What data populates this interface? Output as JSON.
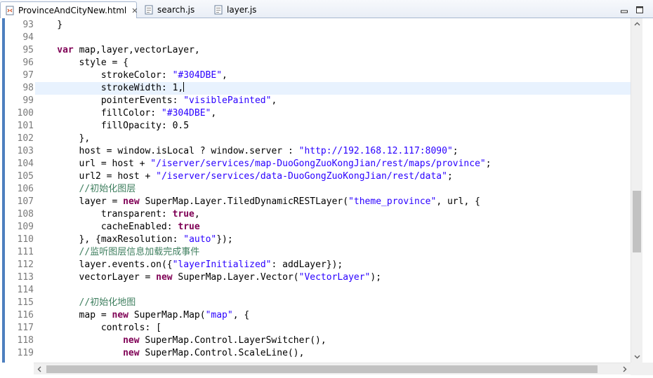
{
  "tabs": [
    {
      "label": "ProvinceAndCityNew.html",
      "icon": "html-file-icon",
      "active": true,
      "closable": true
    },
    {
      "label": "search.js",
      "icon": "js-file-icon",
      "active": false
    },
    {
      "label": "layer.js",
      "icon": "js-file-icon",
      "active": false
    }
  ],
  "window_controls": [
    "minimize-icon",
    "maximize-icon"
  ],
  "editor": {
    "current_line": 98,
    "lines": [
      {
        "n": "93",
        "indent": 1,
        "tokens": [
          {
            "t": "}",
            "c": "plain"
          }
        ]
      },
      {
        "n": "94",
        "indent": 0,
        "tokens": []
      },
      {
        "n": "95",
        "indent": 1,
        "tokens": [
          {
            "t": "var",
            "c": "kw"
          },
          {
            "t": " map,layer,vectorLayer,",
            "c": "plain"
          }
        ]
      },
      {
        "n": "96",
        "indent": 2,
        "tokens": [
          {
            "t": "style = {",
            "c": "plain"
          }
        ]
      },
      {
        "n": "97",
        "indent": 3,
        "tokens": [
          {
            "t": "strokeColor: ",
            "c": "plain"
          },
          {
            "t": "\"#304DBE\"",
            "c": "str"
          },
          {
            "t": ",",
            "c": "plain"
          }
        ]
      },
      {
        "n": "98",
        "indent": 3,
        "tokens": [
          {
            "t": "strokeWidth: 1,",
            "c": "plain"
          }
        ],
        "caret": true
      },
      {
        "n": "99",
        "indent": 3,
        "tokens": [
          {
            "t": "pointerEvents: ",
            "c": "plain"
          },
          {
            "t": "\"visiblePainted\"",
            "c": "str"
          },
          {
            "t": ",",
            "c": "plain"
          }
        ]
      },
      {
        "n": "100",
        "indent": 3,
        "tokens": [
          {
            "t": "fillColor: ",
            "c": "plain"
          },
          {
            "t": "\"#304DBE\"",
            "c": "str"
          },
          {
            "t": ",",
            "c": "plain"
          }
        ]
      },
      {
        "n": "101",
        "indent": 3,
        "tokens": [
          {
            "t": "fillOpacity: 0.5",
            "c": "plain"
          }
        ]
      },
      {
        "n": "102",
        "indent": 2,
        "tokens": [
          {
            "t": "},",
            "c": "plain"
          }
        ]
      },
      {
        "n": "103",
        "indent": 2,
        "tokens": [
          {
            "t": "host = window.isLocal ? window.server : ",
            "c": "plain"
          },
          {
            "t": "\"http://192.168.12.117:8090\"",
            "c": "str"
          },
          {
            "t": ";",
            "c": "plain"
          }
        ]
      },
      {
        "n": "104",
        "indent": 2,
        "tokens": [
          {
            "t": "url = host + ",
            "c": "plain"
          },
          {
            "t": "\"/iserver/services/map-DuoGongZuoKongJian/rest/maps/province\"",
            "c": "str"
          },
          {
            "t": ";",
            "c": "plain"
          }
        ]
      },
      {
        "n": "105",
        "indent": 2,
        "tokens": [
          {
            "t": "url2 = host + ",
            "c": "plain"
          },
          {
            "t": "\"/iserver/services/data-DuoGongZuoKongJian/rest/data\"",
            "c": "str"
          },
          {
            "t": ";",
            "c": "plain"
          }
        ]
      },
      {
        "n": "106",
        "indent": 2,
        "tokens": [
          {
            "t": "//初始化图层",
            "c": "cm"
          }
        ]
      },
      {
        "n": "107",
        "indent": 2,
        "tokens": [
          {
            "t": "layer = ",
            "c": "plain"
          },
          {
            "t": "new",
            "c": "kw"
          },
          {
            "t": " SuperMap.Layer.TiledDynamicRESTLayer(",
            "c": "plain"
          },
          {
            "t": "\"theme_province\"",
            "c": "str"
          },
          {
            "t": ", url, {",
            "c": "plain"
          }
        ]
      },
      {
        "n": "108",
        "indent": 3,
        "tokens": [
          {
            "t": "transparent: ",
            "c": "plain"
          },
          {
            "t": "true",
            "c": "kw"
          },
          {
            "t": ",",
            "c": "plain"
          }
        ]
      },
      {
        "n": "109",
        "indent": 3,
        "tokens": [
          {
            "t": "cacheEnabled: ",
            "c": "plain"
          },
          {
            "t": "true",
            "c": "kw"
          }
        ]
      },
      {
        "n": "110",
        "indent": 2,
        "tokens": [
          {
            "t": "}, {maxResolution: ",
            "c": "plain"
          },
          {
            "t": "\"auto\"",
            "c": "str"
          },
          {
            "t": "});",
            "c": "plain"
          }
        ]
      },
      {
        "n": "111",
        "indent": 2,
        "tokens": [
          {
            "t": "//监听图层信息加载完成事件",
            "c": "cm"
          }
        ]
      },
      {
        "n": "112",
        "indent": 2,
        "tokens": [
          {
            "t": "layer.events.on({",
            "c": "plain"
          },
          {
            "t": "\"layerInitialized\"",
            "c": "str"
          },
          {
            "t": ": addLayer});",
            "c": "plain"
          }
        ]
      },
      {
        "n": "113",
        "indent": 2,
        "tokens": [
          {
            "t": "vectorLayer = ",
            "c": "plain"
          },
          {
            "t": "new",
            "c": "kw"
          },
          {
            "t": " SuperMap.Layer.Vector(",
            "c": "plain"
          },
          {
            "t": "\"VectorLayer\"",
            "c": "str"
          },
          {
            "t": ");",
            "c": "plain"
          }
        ]
      },
      {
        "n": "114",
        "indent": 0,
        "tokens": []
      },
      {
        "n": "115",
        "indent": 2,
        "tokens": [
          {
            "t": "//初始化地图",
            "c": "cm"
          }
        ]
      },
      {
        "n": "116",
        "indent": 2,
        "tokens": [
          {
            "t": "map = ",
            "c": "plain"
          },
          {
            "t": "new",
            "c": "kw"
          },
          {
            "t": " SuperMap.Map(",
            "c": "plain"
          },
          {
            "t": "\"map\"",
            "c": "str"
          },
          {
            "t": ", {",
            "c": "plain"
          }
        ]
      },
      {
        "n": "117",
        "indent": 3,
        "tokens": [
          {
            "t": "controls: [",
            "c": "plain"
          }
        ]
      },
      {
        "n": "118",
        "indent": 4,
        "tokens": [
          {
            "t": "new",
            "c": "kw"
          },
          {
            "t": " SuperMap.Control.LayerSwitcher(),",
            "c": "plain"
          }
        ]
      },
      {
        "n": "119",
        "indent": 4,
        "tokens": [
          {
            "t": "new",
            "c": "kw"
          },
          {
            "t": " SuperMap.Control.ScaleLine(),",
            "c": "plain"
          }
        ]
      }
    ]
  },
  "scrollbars": {
    "vertical": {
      "position": 0.62
    },
    "horizontal": {
      "position": 0.0
    }
  },
  "colors": {
    "keyword": "#7f0055",
    "string": "#2a00ff",
    "comment": "#3f7f5f",
    "current_line": "#e8f2fe",
    "line_number": "#7a7a7a"
  }
}
